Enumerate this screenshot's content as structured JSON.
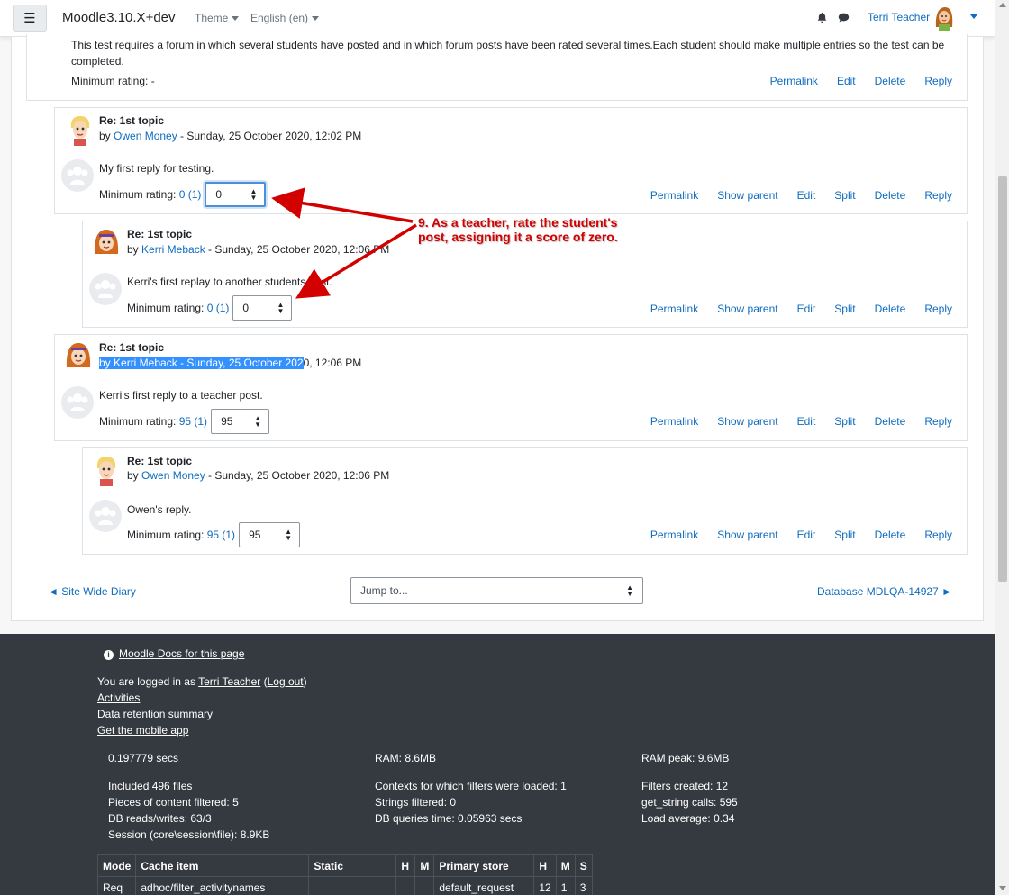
{
  "navbar": {
    "brand": "Moodle3.10.X+dev",
    "theme_label": "Theme",
    "language_label": "English (en)",
    "user_name": "Terri Teacher"
  },
  "parent_post": {
    "body": "This test requires a forum in which several students have posted and in which forum posts have been rated several times.Each student should make multiple entries so the test can be completed.",
    "rating_label": "Minimum rating: -",
    "actions": [
      "Permalink",
      "Edit",
      "Delete",
      "Reply"
    ]
  },
  "posts": [
    {
      "title": "Re: 1st topic",
      "by_prefix": "by ",
      "author": "Owen Money",
      "date": " - Sunday, 25 October 2020, 12:02 PM",
      "body": "My first reply for testing.",
      "rating_label": "Minimum rating:",
      "rating_link": "0 (1)",
      "rating_value": "0",
      "actions": [
        "Permalink",
        "Show parent",
        "Edit",
        "Split",
        "Delete",
        "Reply"
      ]
    },
    {
      "title": "Re: 1st topic",
      "by_prefix": "by ",
      "author": "Kerri Meback",
      "date": " - Sunday, 25 October 2020, 12:06 PM",
      "body": "Kerri's first replay to another students post.",
      "rating_label": "Minimum rating:",
      "rating_link": "0 (1)",
      "rating_value": "0",
      "actions": [
        "Permalink",
        "Show parent",
        "Edit",
        "Split",
        "Delete",
        "Reply"
      ]
    },
    {
      "title": "Re: 1st topic",
      "by_prefix": "by ",
      "author": "Kerri Meback",
      "date_highlighted": " - Sunday, 25 October 202",
      "date_rest": "0, 12:06 PM",
      "body": "Kerri's first reply to a teacher post.",
      "rating_label": "Minimum rating:",
      "rating_link": "95 (1)",
      "rating_value": "95",
      "actions": [
        "Permalink",
        "Show parent",
        "Edit",
        "Split",
        "Delete",
        "Reply"
      ]
    },
    {
      "title": "Re: 1st topic",
      "by_prefix": "by ",
      "author": "Owen Money",
      "date": " - Sunday, 25 October 2020, 12:06 PM",
      "body": "Owen's reply.",
      "rating_label": "Minimum rating:",
      "rating_link": "95 (1)",
      "rating_value": "95",
      "actions": [
        "Permalink",
        "Show parent",
        "Edit",
        "Split",
        "Delete",
        "Reply"
      ]
    }
  ],
  "annotation": {
    "text": "9. As a teacher, rate the student's post, assigning it a score of zero.",
    "color": "#d30000"
  },
  "bottom_nav": {
    "prev": "◄ Site Wide Diary",
    "jump_placeholder": "Jump to...",
    "next": "Database MDLQA-14927 ►"
  },
  "footer": {
    "docs_link": "Moodle Docs for this page",
    "logged_in_prefix": "You are logged in as ",
    "logged_in_user": "Terri Teacher",
    "logout_open": " (",
    "logout": "Log out",
    "logout_close": ")",
    "links": [
      "Activities",
      "Data retention summary",
      "Get the mobile app"
    ],
    "perf": {
      "secs": "0.197779 secs",
      "ram": "RAM: 8.6MB",
      "ram_peak": "RAM peak: 9.6MB",
      "included": "Included 496 files",
      "pieces": "Pieces of content filtered: 5",
      "db_rw": "DB reads/writes: 63/3",
      "session": "Session (core\\session\\file): 8.9KB",
      "contexts": "Contexts for which filters were loaded: 1",
      "strings": "Strings filtered: 0",
      "db_time": "DB queries time: 0.05963 secs",
      "filters_created": "Filters created: 12",
      "get_string": "get_string calls: 595",
      "load_avg": "Load average: 0.34"
    },
    "table": {
      "headers": [
        "Mode",
        "Cache item",
        "Static",
        "H",
        "M",
        "Primary store",
        "H",
        "M",
        "S"
      ],
      "row": [
        "Req",
        "adhoc/filter_activitynames",
        "",
        "",
        "",
        "default_request",
        "12",
        "1",
        "3"
      ]
    }
  }
}
